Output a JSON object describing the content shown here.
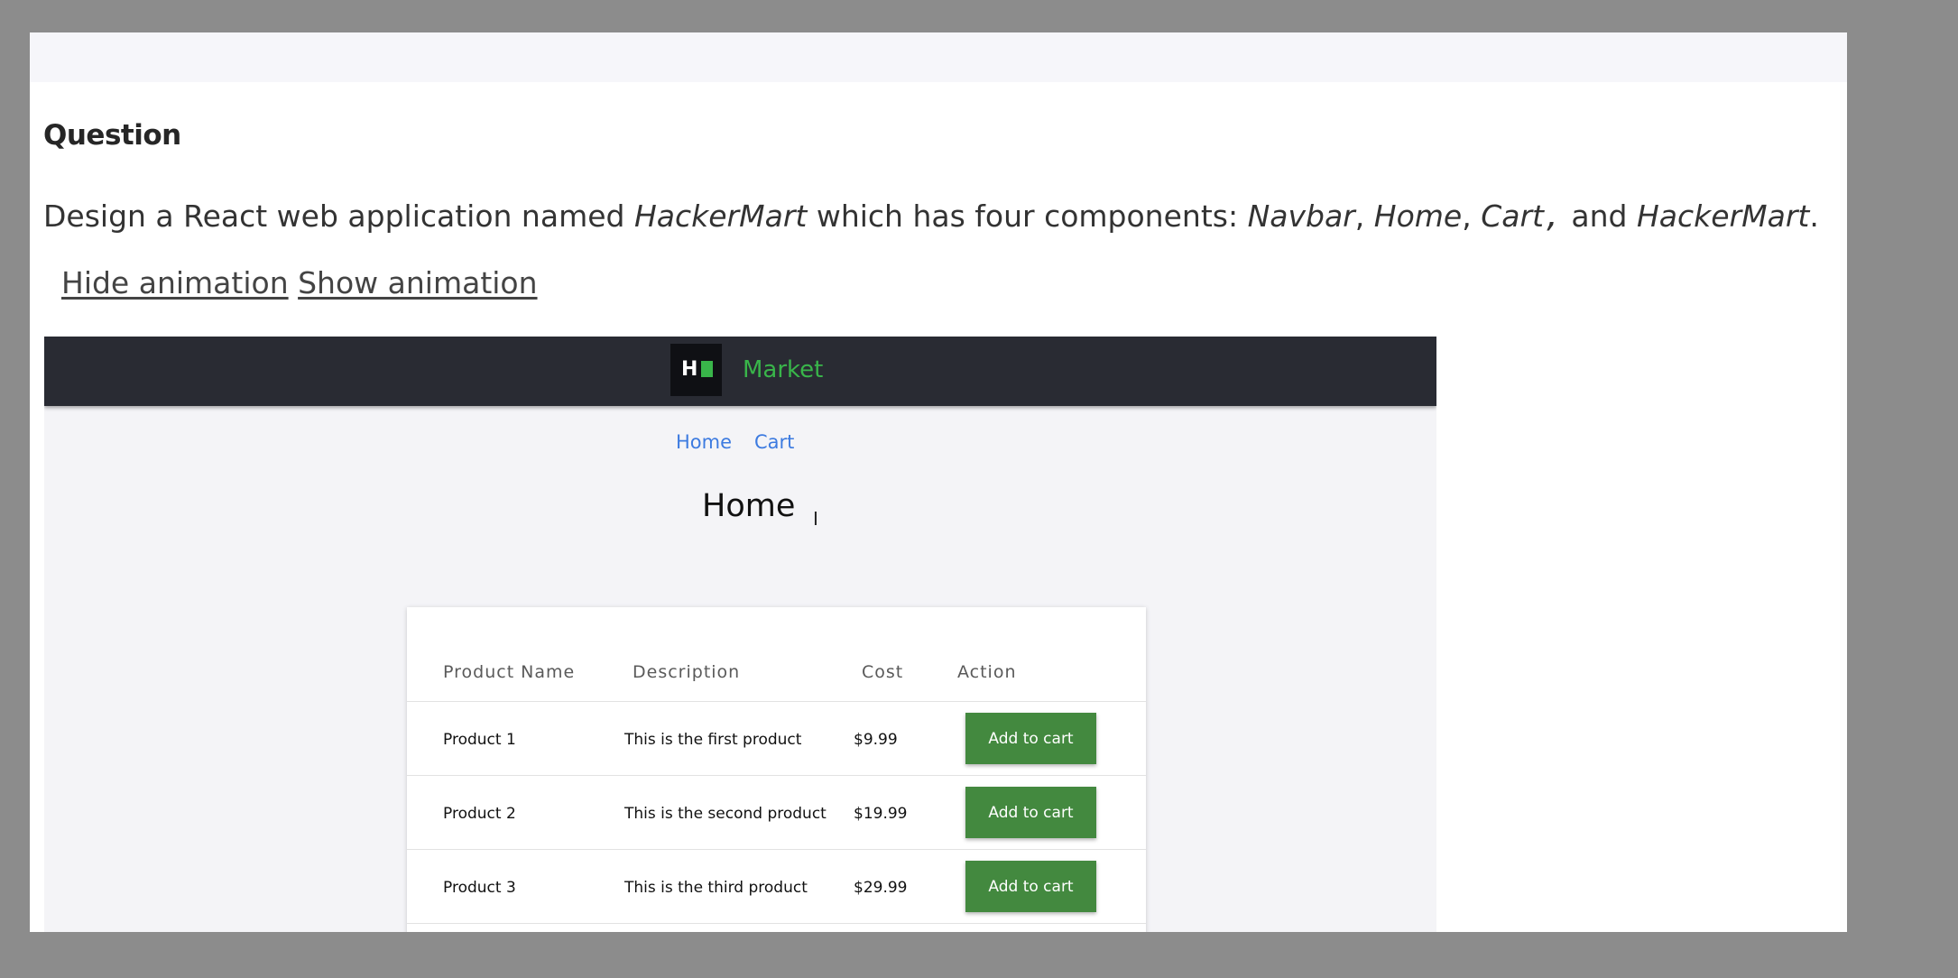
{
  "question": {
    "heading": "Question",
    "intro": "Design a React web application named",
    "app_name": "HackerMart",
    "middle": "which has four components:",
    "comp1": "Navbar",
    "sep1": ",",
    "comp2": "Home",
    "sep2": ",",
    "comp3": "Cart",
    "sep3": ",",
    "and": "and",
    "comp4": "HackerMart",
    "end": "."
  },
  "animation": {
    "hide_label": "Hide animation",
    "show_label": "Show animation"
  },
  "app": {
    "logo_letter": "H",
    "brand": "Market",
    "nav": {
      "home": "Home",
      "cart": "Cart"
    },
    "page_title": "Home",
    "cursor_glyph": "I",
    "table": {
      "headers": [
        "Product Name",
        "Description",
        "Cost",
        "Action"
      ],
      "rows": [
        {
          "name": "Product 1",
          "description": "This is the first product",
          "cost": "$9.99",
          "action": "Add to cart"
        },
        {
          "name": "Product 2",
          "description": "This is the second product",
          "cost": "$19.99",
          "action": "Add to cart"
        },
        {
          "name": "Product 3",
          "description": "This is the third product",
          "cost": "$29.99",
          "action": "Add to cart"
        }
      ]
    },
    "colors": {
      "navbar": "#292b33",
      "brand": "#39b54a",
      "button": "#43893f",
      "link": "#3d7be0"
    }
  }
}
